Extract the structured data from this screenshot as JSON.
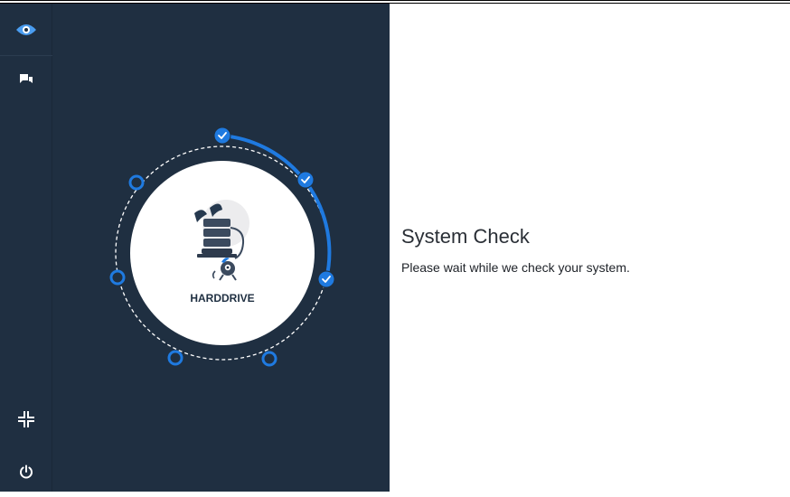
{
  "sidebar": {
    "items": [
      {
        "name": "eye-logo-icon"
      },
      {
        "name": "chat-icon"
      },
      {
        "name": "minimize-icon"
      },
      {
        "name": "power-icon"
      }
    ]
  },
  "check": {
    "current_label": "HARDDRIVE",
    "steps_total": 7,
    "steps_complete": 3
  },
  "main": {
    "title": "System Check",
    "message": "Please wait while we check your system."
  },
  "colors": {
    "sidebar_bg": "#1f2f41",
    "accent": "#1f7ae0",
    "text_dark": "#2a2f36"
  }
}
